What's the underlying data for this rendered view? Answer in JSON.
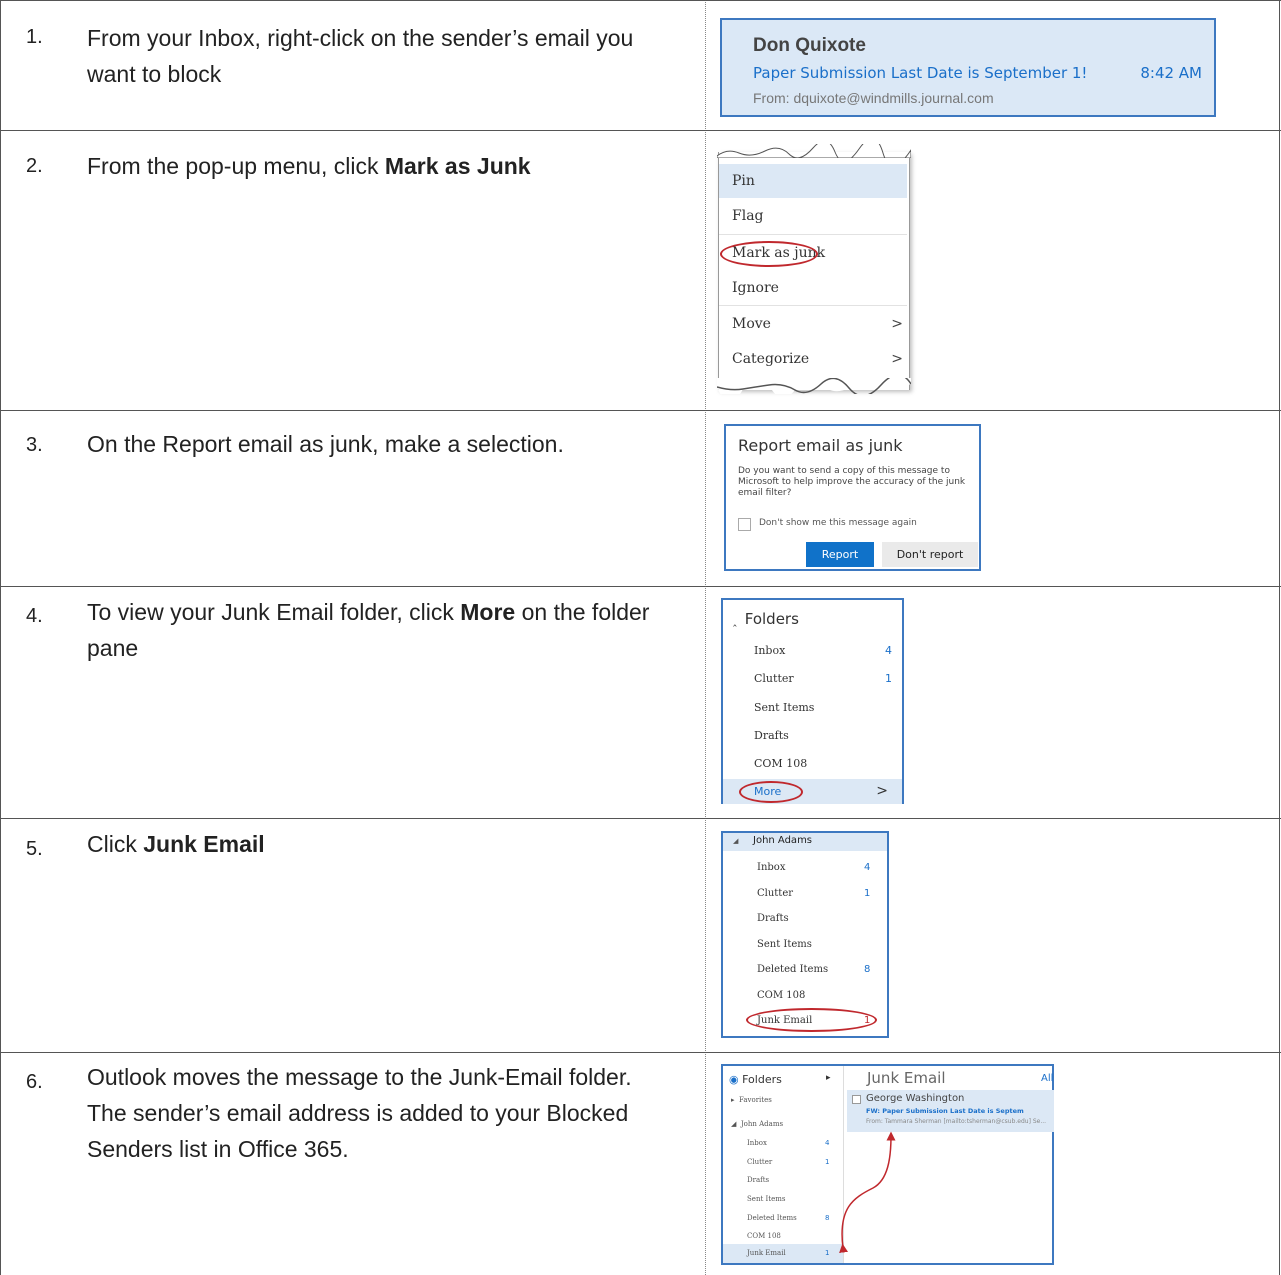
{
  "steps": [
    {
      "number": "1.",
      "text_parts": [
        "From your Inbox, right-click on the sender’s email you want to block"
      ]
    },
    {
      "number": "2.",
      "text_plain": "From the pop-up menu, click ",
      "text_bold": "Mark as Junk"
    },
    {
      "number": "3.",
      "text_plain": "On the Report email as junk, make a selection."
    },
    {
      "number": "4.",
      "text_plain": "To view your Junk Email folder, click ",
      "text_bold": "More",
      "text_after": " on the folder pane"
    },
    {
      "number": "5.",
      "text_plain": "Click ",
      "text_bold": "Junk Email"
    },
    {
      "number": "6.",
      "text_plain": "Outlook moves the message to the Junk-Email folder. The sender’s email address is added to your Blocked Senders list in Office 365."
    }
  ],
  "email_card": {
    "sender": "Don Quixote",
    "subject": "Paper Submission Last Date is September 1!",
    "time": "8:42 AM",
    "from": "From: dquixote@windmills.journal.com"
  },
  "context_menu": {
    "items": [
      "Pin",
      "Flag",
      "Mark as junk",
      "Ignore",
      "Move",
      "Categorize"
    ],
    "submenu_arrow": ">"
  },
  "report_dialog": {
    "title": "Report email as junk",
    "body": "Do you want to send a copy of this message to Microsoft to help improve the accuracy of the junk email filter?",
    "checkbox_label": "Don't show me this message again",
    "report_button": "Report",
    "dont_report_button": "Don't report"
  },
  "folders_pane": {
    "header": "Folders",
    "caret": "^",
    "folders": [
      {
        "name": "Inbox",
        "count": "4"
      },
      {
        "name": "Clutter",
        "count": "1"
      },
      {
        "name": "Sent Items",
        "count": ""
      },
      {
        "name": "Drafts",
        "count": ""
      },
      {
        "name": "COM 108",
        "count": ""
      }
    ],
    "more": "More",
    "more_arrow": ">"
  },
  "account_pane": {
    "account": "John Adams",
    "folders": [
      {
        "name": "Inbox",
        "count": "4"
      },
      {
        "name": "Clutter",
        "count": "1"
      },
      {
        "name": "Drafts",
        "count": ""
      },
      {
        "name": "Sent Items",
        "count": ""
      },
      {
        "name": "Deleted Items",
        "count": "8"
      },
      {
        "name": "COM 108",
        "count": ""
      },
      {
        "name": "Junk Email",
        "count": "1"
      }
    ]
  },
  "outlook_view": {
    "folders_header": "Folders",
    "favorites": "Favorites",
    "account": "John Adams",
    "folders": [
      {
        "name": "Inbox",
        "count": "4"
      },
      {
        "name": "Clutter",
        "count": "1"
      },
      {
        "name": "Drafts",
        "count": ""
      },
      {
        "name": "Sent Items",
        "count": ""
      },
      {
        "name": "Deleted Items",
        "count": "8"
      },
      {
        "name": "COM 108",
        "count": ""
      },
      {
        "name": "Junk Email",
        "count": "1"
      }
    ],
    "pane_title": "Junk Email",
    "all": "All",
    "message": {
      "sender": "George Washington",
      "subject": "FW: Paper Submission Last Date is Septem",
      "from": "From: Tammara Sherman [mailto:tsherman@csub.edu] Se..."
    }
  }
}
